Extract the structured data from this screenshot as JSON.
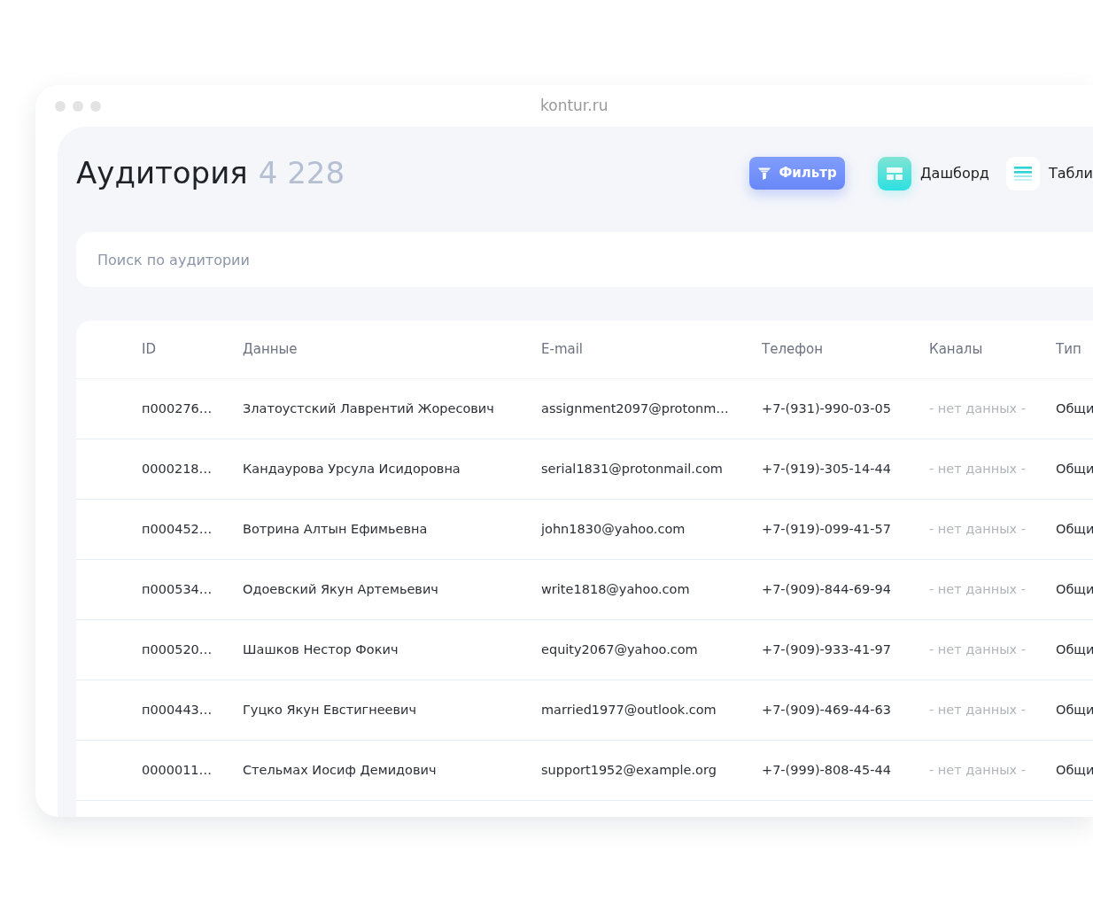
{
  "window": {
    "address": "kontur.ru"
  },
  "header": {
    "title": "Аудитория",
    "count": "4 228"
  },
  "toolbar": [
    {
      "kind": "filter",
      "label": "Фильтр"
    },
    {
      "kind": "dashboard",
      "label": "Дашборд"
    },
    {
      "kind": "table",
      "label": "Табли"
    }
  ],
  "search": {
    "placeholder": "Поиск по аудитории"
  },
  "table": {
    "columns": [
      {
        "label": "ID",
        "kind": "text"
      },
      {
        "label": "Данные",
        "kind": "text"
      },
      {
        "label": "E-mail",
        "kind": "text"
      },
      {
        "label": "Телефон",
        "kind": "text"
      },
      {
        "label": "Каналы",
        "kind": "muted"
      },
      {
        "label": "Тип",
        "kind": "text"
      }
    ],
    "rows": [
      [
        "п000276…",
        "Златоустский Лаврентий Жоресович",
        "assignment2097@protonm…",
        "+7-(931)-990-03-05",
        "- нет данных -",
        "Общи"
      ],
      [
        "0000218…",
        "Кандаурова Урсула Исидоровна",
        "serial1831@protonmail.com",
        "+7-(919)-305-14-44",
        "- нет данных -",
        "Общи"
      ],
      [
        "п000452…",
        "Вотрина Алтын Ефимьевна",
        "john1830@yahoo.com",
        "+7-(919)-099-41-57",
        "- нет данных -",
        "Общи"
      ],
      [
        "п000534…",
        "Одоевский Якун Артемьевич",
        "write1818@yahoo.com",
        "+7-(909)-844-69-94",
        "- нет данных -",
        "Общи"
      ],
      [
        "п000520…",
        "Шашков Нестор Фокич",
        "equity2067@yahoo.com",
        "+7-(909)-933-41-97",
        "- нет данных -",
        "Общи"
      ],
      [
        "п000443…",
        "Гуцко Якун Евстигнеевич",
        "married1977@outlook.com",
        "+7-(909)-469-44-63",
        "- нет данных -",
        "Общи"
      ],
      [
        "0000011…",
        "Стельмах Иосиф Демидович",
        "support1952@example.org",
        "+7-(999)-808-45-44",
        "- нет данных -",
        "Общи"
      ]
    ]
  }
}
